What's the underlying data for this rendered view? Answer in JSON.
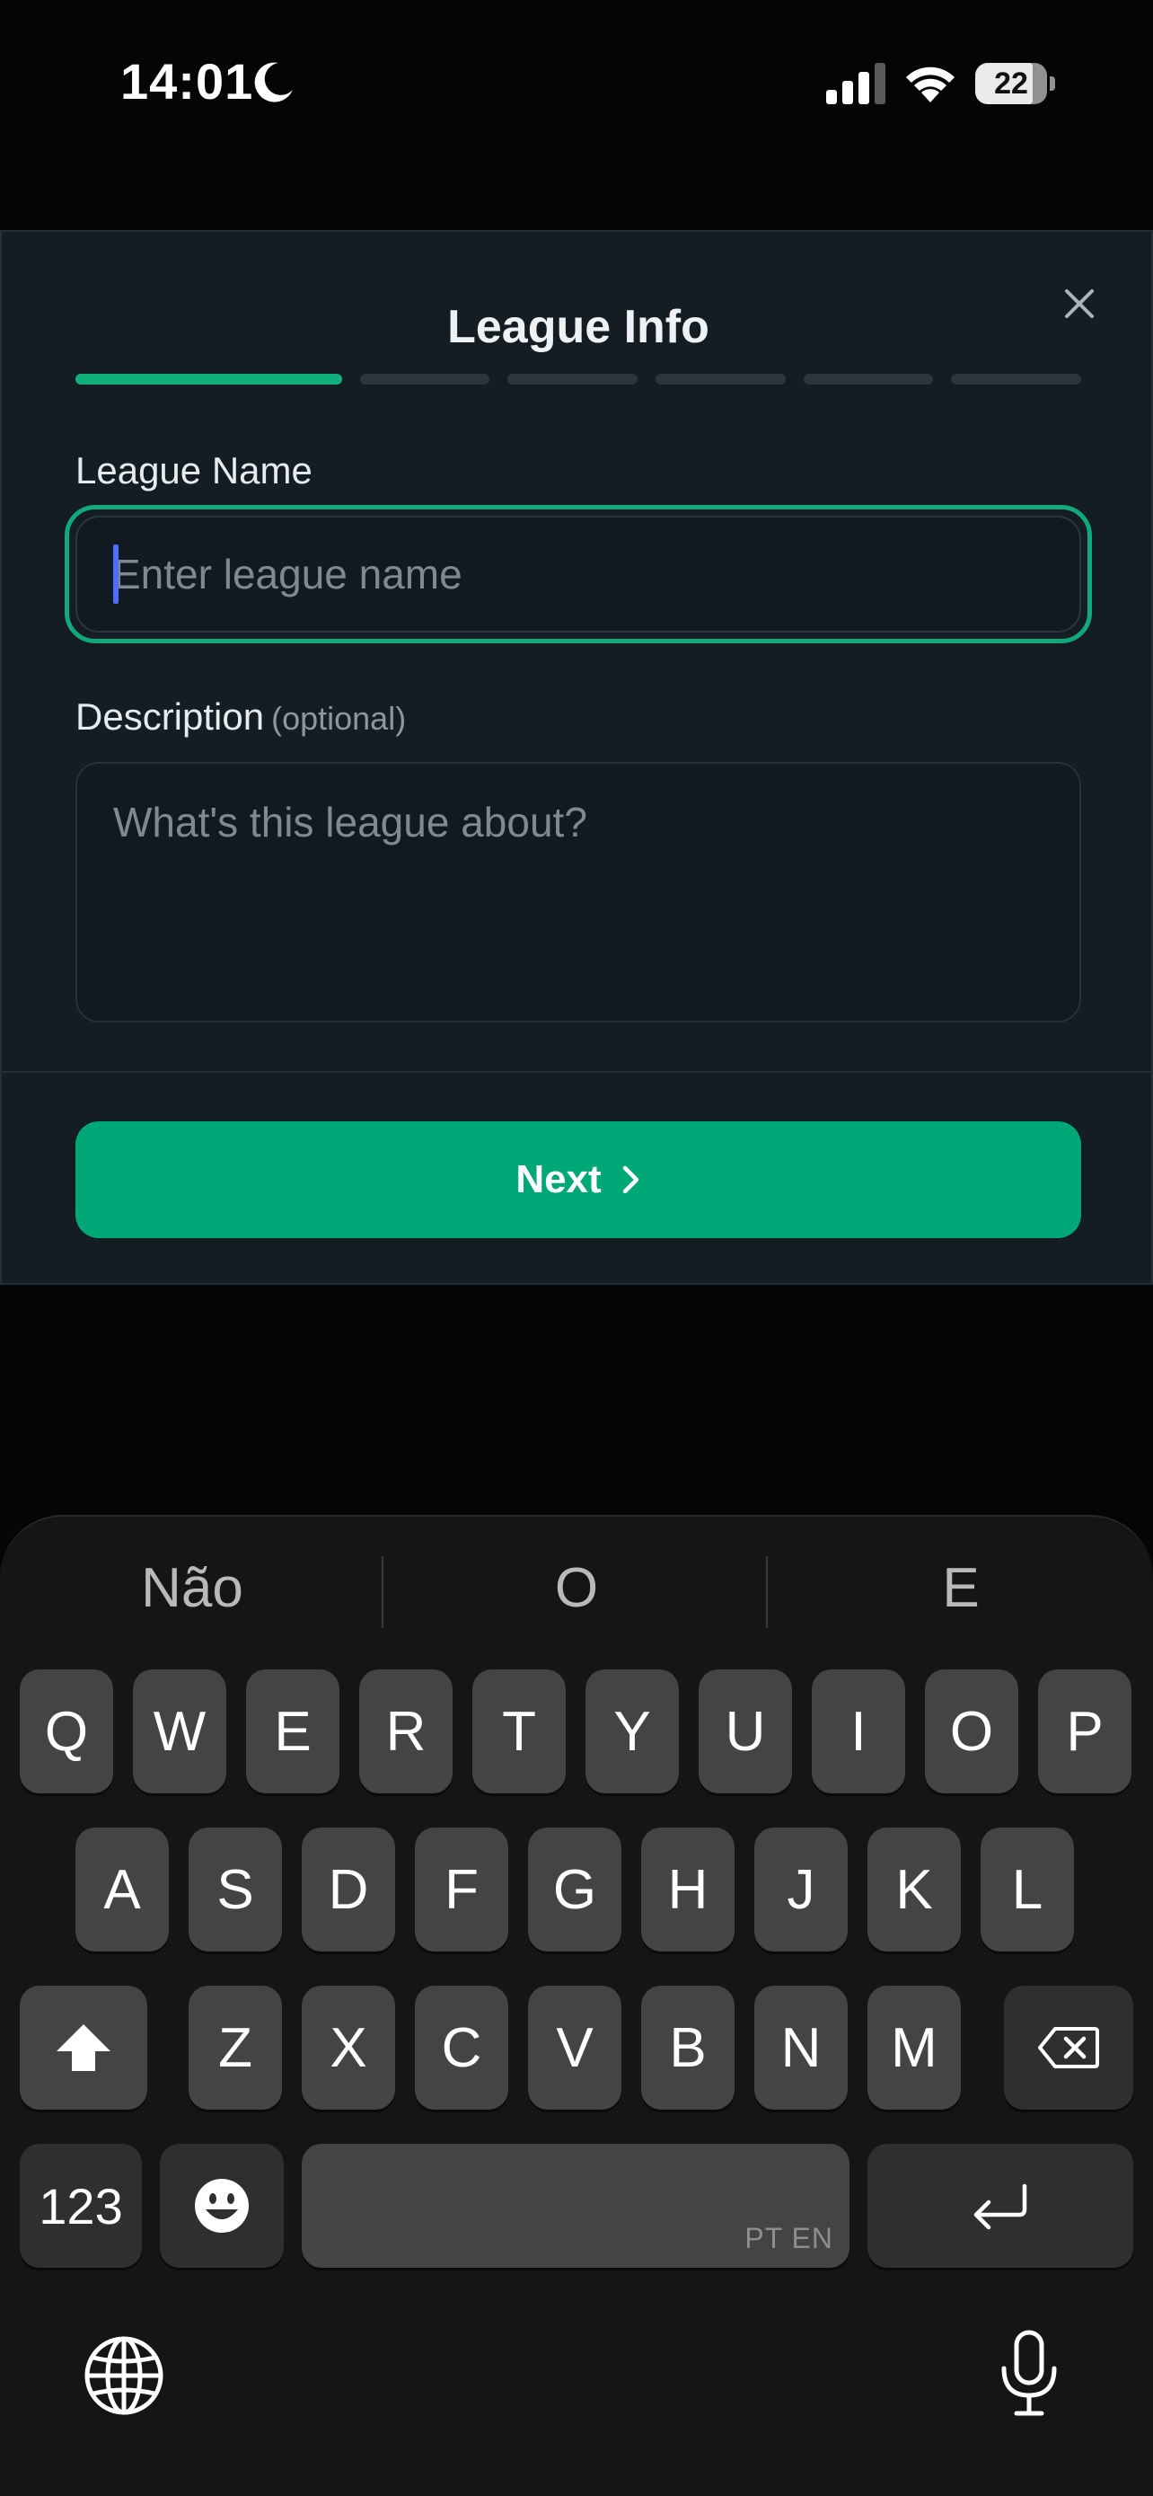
{
  "status_bar": {
    "time": "14:01",
    "battery": "22"
  },
  "modal": {
    "title": "League Info",
    "progress": {
      "total_steps": 6,
      "current_step": 1
    },
    "name_field": {
      "label": "League Name",
      "placeholder": "Enter league name",
      "value": ""
    },
    "description_field": {
      "label": "Description",
      "optional_note": "(optional)",
      "placeholder": "What's this league about?",
      "value": ""
    },
    "next_button": {
      "label": "Next"
    }
  },
  "keyboard": {
    "suggestions": [
      "Não",
      "O",
      "E"
    ],
    "row1": [
      "Q",
      "W",
      "E",
      "R",
      "T",
      "Y",
      "U",
      "I",
      "O",
      "P"
    ],
    "row2": [
      "A",
      "S",
      "D",
      "F",
      "G",
      "H",
      "J",
      "K",
      "L"
    ],
    "row3": [
      "Z",
      "X",
      "C",
      "V",
      "B",
      "N",
      "M"
    ],
    "numbers_key": "123",
    "space_languages": "PT EN"
  },
  "colors": {
    "accent": "#00a878",
    "focus_ring": "#12a97a",
    "modal_bg": "#141d24",
    "keyboard_bg": "#151515",
    "key_bg": "#444444",
    "caret": "#4f6cff"
  }
}
